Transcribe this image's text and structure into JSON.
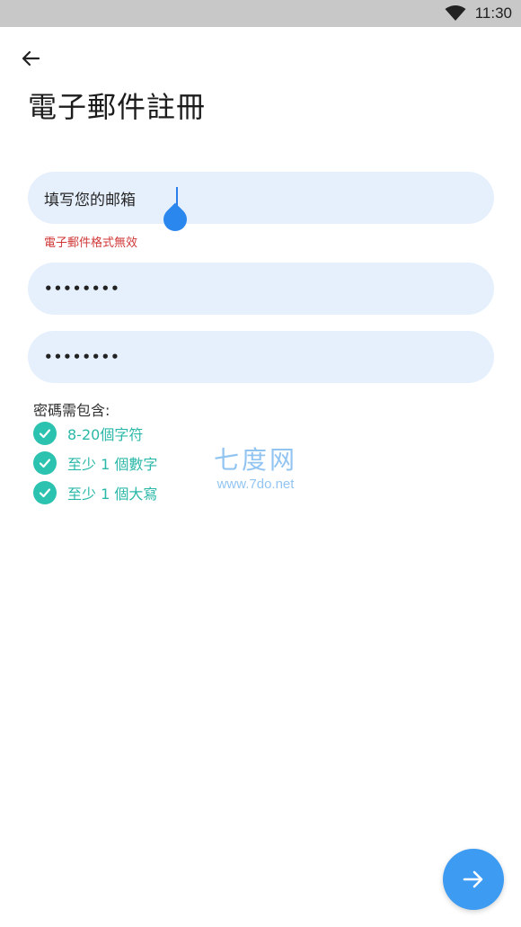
{
  "status_bar": {
    "time": "11:30",
    "wifi_icon": "wifi-icon"
  },
  "header": {
    "back_icon": "arrow-left-icon",
    "title": "電子郵件註冊"
  },
  "form": {
    "email": {
      "value": "填写您的邮箱",
      "error": "電子郵件格式無效"
    },
    "password": {
      "masked_value": "••••••••"
    },
    "confirm_password": {
      "masked_value": "••••••••"
    }
  },
  "requirements": {
    "heading": "密碼需包含:",
    "items": [
      {
        "label": "8-20個字符",
        "met": true
      },
      {
        "label": "至少 1 個數字",
        "met": true
      },
      {
        "label": "至少 1 個大寫",
        "met": true
      }
    ]
  },
  "watermark": {
    "main": "七度网",
    "sub": "www.7do.net"
  },
  "next": {
    "icon": "arrow-right-icon"
  },
  "colors": {
    "accent": "#3d9bf2",
    "field_bg": "#e6f0fd",
    "error": "#d03838",
    "check": "#2bc2b0"
  }
}
